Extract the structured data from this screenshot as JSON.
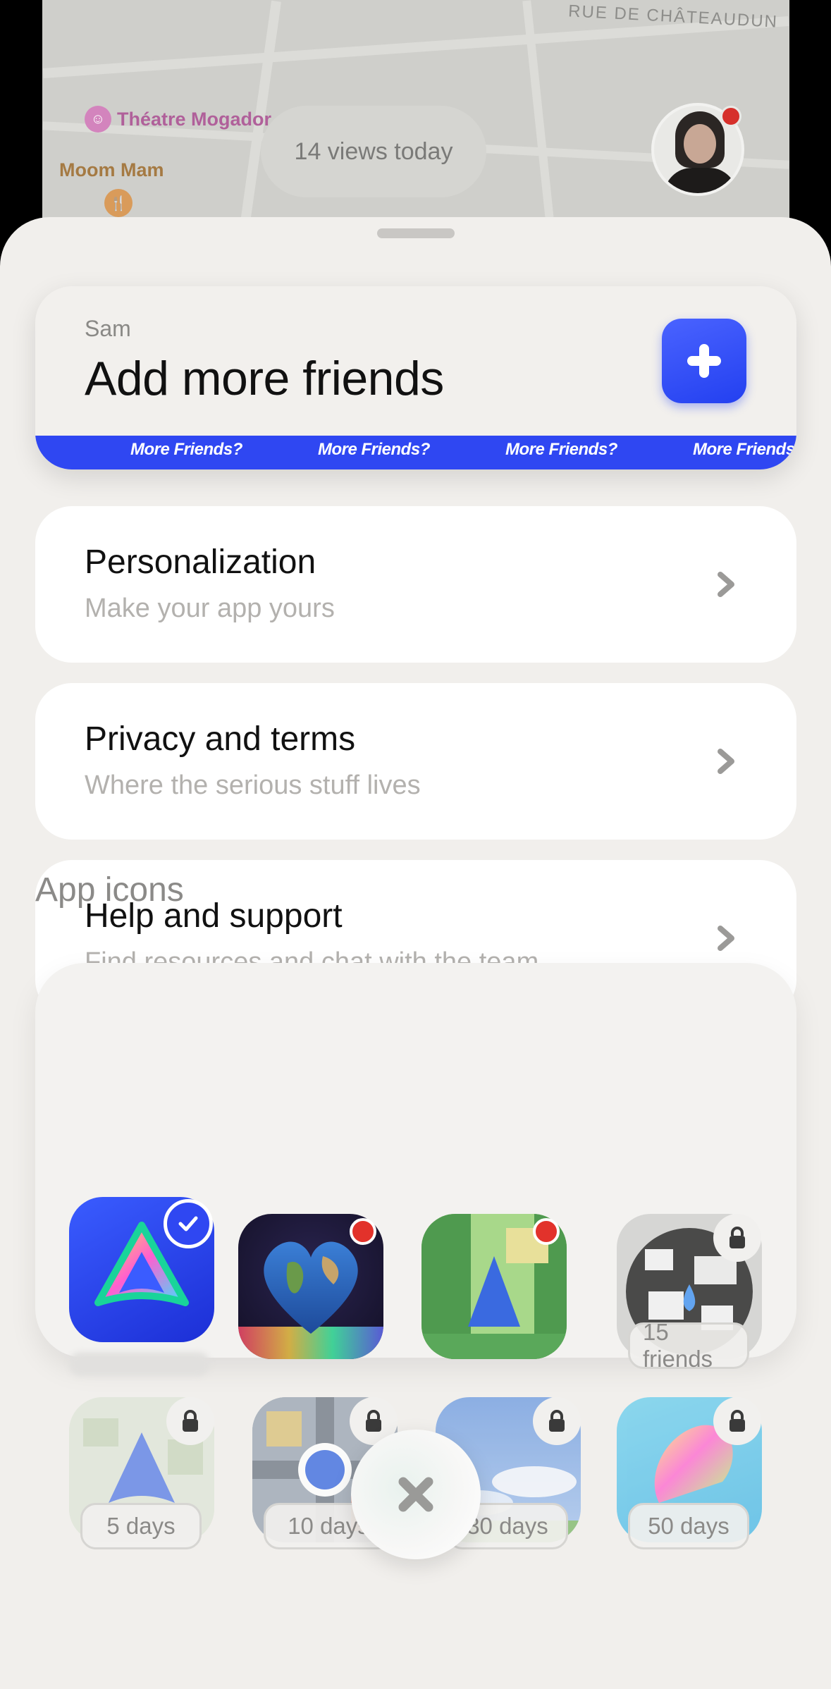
{
  "map": {
    "street_name": "RUE DE CHÂTEAUDUN",
    "poi_theatre": "Théatre Mogador",
    "poi_restaurant": "Moom Mam",
    "views_today": "14 views today"
  },
  "friends_card": {
    "user_name": "Sam",
    "title": "Add more friends",
    "ticker_text": "More Friends?"
  },
  "menu": [
    {
      "title": "Personalization",
      "subtitle": "Make your app yours"
    },
    {
      "title": "Privacy and terms",
      "subtitle": "Where the serious stuff lives"
    },
    {
      "title": "Help and support",
      "subtitle": "Find resources and chat with the team"
    }
  ],
  "app_icons": {
    "section_title": "App icons",
    "requirements": [
      "15 friends",
      "5 days",
      "10 days",
      "30 days",
      "50 days"
    ]
  },
  "colors": {
    "accent": "#2f47f2",
    "sheet_bg": "#f1efec",
    "notification": "#e2322b"
  }
}
